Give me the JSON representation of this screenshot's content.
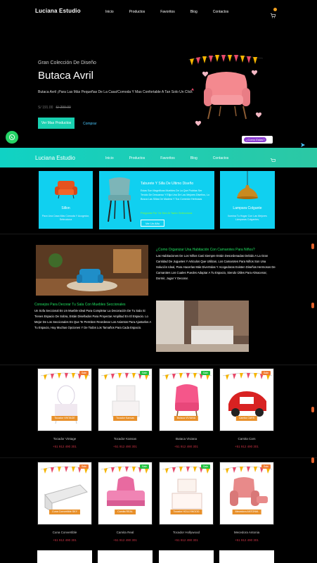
{
  "nav": {
    "brand": "Luciana Estudio",
    "links": [
      "Inicio",
      "Productos",
      "Favoritos",
      "Blog",
      "Contactos"
    ]
  },
  "hero": {
    "subtitle": "Gran Colección De Diseño",
    "title": "Butaca Avril",
    "description": "Butaca Avril ¡Para Las Más Pequeñas De La Casa!Comoda Y Mas Confortable A Tan Solo Un Click",
    "price_new": "S/ 191.00",
    "price_old": "S/ 299.00",
    "button": "Ver Mas Productos",
    "link": "Comprar"
  },
  "chat": {
    "label": "¿Como Estas?"
  },
  "bar2": {
    "brand": "Luciana Estudio",
    "links": [
      "Inicio",
      "Productos",
      "Favoritos",
      "Blog",
      "Contactos"
    ]
  },
  "categories": {
    "sillon": {
      "name": "Sillon",
      "desc": "Para Una Casa Más Cómoda Y Acogedor, Selecciona"
    },
    "taburete": {
      "title": "Taburete Y Silla De Ultimo Diseño",
      "desc": "Estas Son Magnificas Muebles De La Que Podrias Ser Tenido De Descanso Y Elija Una De Las Mejores Diseños, Lo Busca Las Sillas De Madera Y Tus Comedor Herbosas",
      "highlight": "Pregunta Por Ya Sea Al Tanto Selecciona",
      "button": "Ver Un Año"
    },
    "lampara": {
      "name": "Lampara Colgante",
      "desc": "Ilumina Tu Hogar Con Las Mejores Lámparas Colgantes."
    }
  },
  "articles": {
    "a1_title": "¿Como Organizar Una Habitación Con Camarotes Para Niños?",
    "a1_text": "Las Habitaciones De Los Niños Casi Siempre Están Desordenadas Debido A La Gran Cantidad De Juguetes Y Articulos Que Utilizan, Los Camarotes Para Niños Son Una Solución Ideal, Para Hacerlas Más DiverSdas Y Acogedoras Existen Diseños Hermosos De Camarotes Los Cuales Puedes Adaptar A Tu Espacio, Siendo Útiles Para Almacenar, Dormir, Jugar Y Decorar.",
    "a2_title": "Consejos Para Decorar Tu Sala Con Muebles Seccionales",
    "a2_text": "Un Sofa Seccional Es Un Mueble Ideal Para Completar La Decoración De Tu Sala Si Tienes Espacio De Sobra, Están Diseñados Para Proyectar Amplitud En El Espacio. Lo Mejor De Los Seccionales Es Que Te Permiten Reordenar Los Asientos Para Ajustarlos A Tu Espacio, Hay Muchas Opciones Y De Todos Los Tamaños Para Cada Espacio."
  },
  "products": [
    {
      "title": "Tocador Vintage",
      "band": "Tocador VINTAGE",
      "badge": "Sale",
      "badge_color": "#f07a30",
      "phone": "+51 912 490 301"
    },
    {
      "title": "Tocador Kansas",
      "band": "Tocador Kansas",
      "badge": "Sale",
      "badge_color": "#20c040",
      "phone": "+51 912 490 301"
    },
    {
      "title": "Butaca Viviana",
      "band": "Butaca VIVIANA",
      "badge": "Sale",
      "badge_color": "#20c040",
      "phone": "+51 912 490 301"
    },
    {
      "title": "Camita Cars",
      "band": "Camita CARS",
      "badge": "Sale",
      "badge_color": "#f07a30",
      "phone": "+51 912 490 301"
    },
    {
      "title": "Cuna Convertible",
      "band": "Cuna Convertible SKY",
      "badge": "Sale",
      "badge_color": "#f07a30",
      "phone": "+51 912 490 301"
    },
    {
      "title": "Camita Real",
      "band": "Camita REAL",
      "badge": "Sale",
      "badge_color": "#20c040",
      "phone": "+51 912 490 301"
    },
    {
      "title": "Tocador Hollywood",
      "band": "Tocador HOLLYWOOD",
      "badge": "Sale",
      "badge_color": "#20c040",
      "phone": "+51 912 490 301"
    },
    {
      "title": "Mecedora Antonia",
      "band": "Mecedora ANTONIA",
      "badge": "Sale",
      "badge_color": "#f07a30",
      "phone": "+51 912 490 301"
    }
  ]
}
